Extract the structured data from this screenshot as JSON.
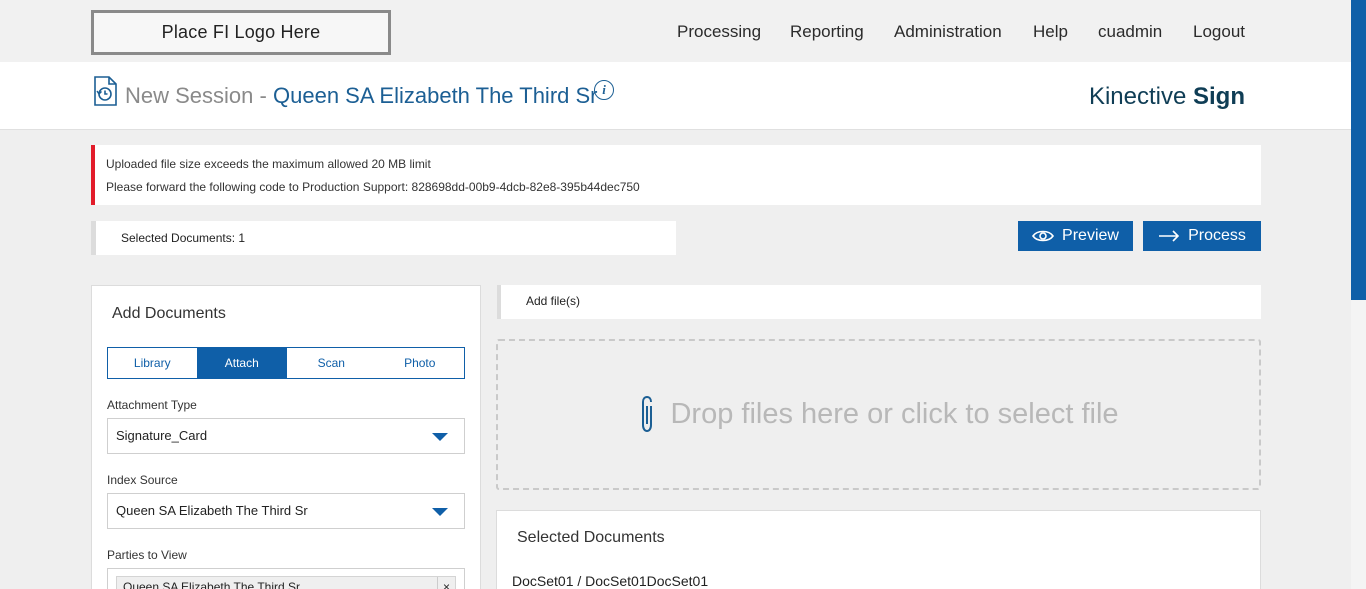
{
  "header": {
    "logo_placeholder": "Place FI Logo Here",
    "nav": [
      "Processing",
      "Reporting",
      "Administration",
      "Help",
      "cuadmin",
      "Logout"
    ]
  },
  "session": {
    "prefix": "New Session -",
    "name": "Queen SA Elizabeth The Third Sr",
    "brand_light": "Kinective",
    "brand_bold": "Sign",
    "icons": [
      "document-history-icon",
      "info-icon"
    ]
  },
  "alert": {
    "line1": "Uploaded file size exceeds the maximum allowed 20 MB limit",
    "line2": "Please forward the following code to Production Support: 828698dd-00b9-4dcb-82e8-395b44dec750",
    "accent_color": "#e21c2a"
  },
  "toolbar": {
    "selected_documents": "Selected Documents: 1",
    "preview_label": "Preview",
    "process_label": "Process"
  },
  "add_documents": {
    "title": "Add Documents",
    "tabs": [
      "Library",
      "Attach",
      "Scan",
      "Photo"
    ],
    "active_tab": "Attach",
    "attachment_type_label": "Attachment Type",
    "attachment_type_value": "Signature_Card",
    "index_source_label": "Index Source",
    "index_source_value": "Queen SA Elizabeth The Third Sr",
    "parties_label": "Parties to View",
    "parties_chip": "Queen SA Elizabeth The Third Sr",
    "chip_remove": "×"
  },
  "files": {
    "add_files_label": "Add file(s)",
    "drop_text": "Drop files here or click to select file",
    "selected_title": "Selected Documents",
    "docset": "DocSet01 / DocSet01DocSet01"
  },
  "colors": {
    "primary": "#0f5fa8",
    "link": "#1c5f94",
    "brand": "#0f3d55"
  }
}
